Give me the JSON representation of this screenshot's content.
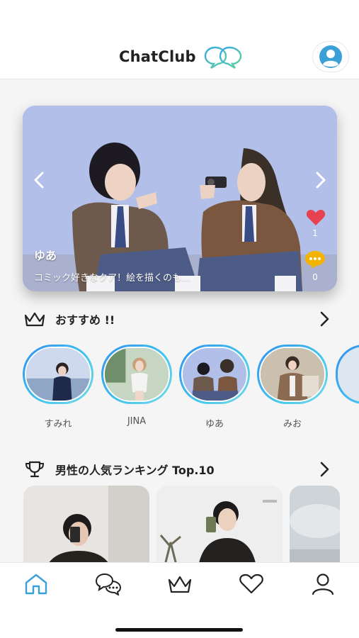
{
  "header": {
    "app_title": "ChatClub",
    "logo_icon": "chat-bubbles-icon",
    "profile_icon": "user-avatar-icon"
  },
  "hero": {
    "name": "ゆあ",
    "caption": "コミック好きなクア！絵を描くのも…",
    "likes": "1",
    "comments": "0",
    "prev_icon": "chevron-left-icon",
    "next_icon": "chevron-right-icon"
  },
  "recommended": {
    "title": "おすすめ !!",
    "icon": "crown-icon",
    "items": [
      {
        "name": "すみれ"
      },
      {
        "name": "JINA"
      },
      {
        "name": "ゆあ"
      },
      {
        "name": "みお"
      }
    ]
  },
  "ranking": {
    "title": "男性の人気ランキング Top.10",
    "icon": "trophy-icon"
  },
  "tabbar": {
    "items": [
      "home-icon",
      "chat-icon",
      "crown-icon",
      "heart-icon",
      "profile-icon"
    ],
    "active": "home-icon"
  },
  "colors": {
    "accent": "#3aa0d8",
    "like": "#e8414f",
    "comment": "#f2b400"
  }
}
